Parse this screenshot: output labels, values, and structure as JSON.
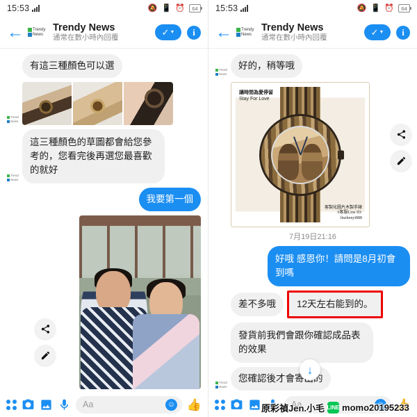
{
  "status_bar": {
    "time": "15:53",
    "signal_icon": "signal-bars-icon",
    "mute_icon": "bell-muted-icon",
    "vibrate_icon": "vibrate-icon",
    "alarm_icon": "alarm-clock-icon",
    "battery_level": "64"
  },
  "header": {
    "back_icon": "back-arrow-icon",
    "avatar_name": "Trendy News",
    "avatar_line1": "Trendy",
    "avatar_line2": "News",
    "title": "Trendy News",
    "subtitle": "通常在數小時內回覆",
    "check_icon": "check-dropdown-icon",
    "info_icon": "info-icon"
  },
  "colors": {
    "accent_blue": "#1b8ef2",
    "bubble_in": "#f0f0f0",
    "highlight_red": "#ee0000",
    "line_green": "#06c755",
    "logo_green": "#3cb54a"
  },
  "left_panel": {
    "messages": [
      {
        "id": "m1",
        "type": "text",
        "side": "in",
        "text": "有這三種顏色可以選"
      },
      {
        "id": "m2",
        "type": "photo_row",
        "side": "in",
        "photos": [
          "watch-photo-light-wood",
          "watch-photo-tan-wood",
          "watch-photo-dark-wood"
        ]
      },
      {
        "id": "m3",
        "type": "text",
        "side": "in",
        "text": "這三種顏色的草圖都會給您參考的，您看完後再選您最喜歡的就好"
      },
      {
        "id": "m4",
        "type": "text",
        "side": "out",
        "text": "我要第一個"
      },
      {
        "id": "m5",
        "type": "photo",
        "side": "out",
        "photo": "couple-yukata-photo"
      }
    ],
    "share_icon": "share-icon",
    "edit_icon": "pen-edit-icon",
    "scroll_down_icon": "scroll-to-bottom-icon"
  },
  "right_panel": {
    "messages": [
      {
        "id": "r1",
        "type": "text",
        "side": "in",
        "text": "好的，稍等哦"
      },
      {
        "id": "r2",
        "type": "card",
        "side": "in",
        "card": {
          "title_zh": "讓時間為愛停留",
          "title_en": "Stay For Love",
          "foot_line1": "客製化圖片木製手錶",
          "foot_line2": "6客服Line ID:",
          "foot_line3": "linzhenyi888",
          "image": "engraved-couple-wooden-watch"
        }
      },
      {
        "id": "r3",
        "type": "timestamp",
        "text": "7月19日21:16"
      },
      {
        "id": "r4",
        "type": "text",
        "side": "out",
        "text": "好哦 感恩你！請問是8月初會到嗎"
      },
      {
        "id": "r5",
        "type": "text_pair",
        "side": "in",
        "text": "差不多哦",
        "highlighted_text": "12天左右能到的。",
        "highlighted": true
      },
      {
        "id": "r6",
        "type": "text",
        "side": "in",
        "text": "發貨前我們會跟你確認成品表的效果"
      },
      {
        "id": "r7",
        "type": "text",
        "side": "in",
        "text": "您確認後才會寄出的"
      }
    ],
    "share_icon": "share-icon",
    "edit_icon": "pen-edit-icon",
    "scroll_down_icon": "scroll-to-bottom-icon"
  },
  "composer": {
    "menu_icon": "app-grid-icon",
    "camera_icon": "camera-icon",
    "gallery_icon": "gallery-icon",
    "mic_icon": "microphone-icon",
    "input_placeholder": "Aa",
    "input_value": "",
    "emoji_icon": "smiley-icon",
    "like_icon": "thumbs-up-icon"
  },
  "watermark": {
    "name": "原彩禎Jen.小毛",
    "line_icon": "line-app-icon",
    "line_label": "LINE",
    "account_id": "momo20195233"
  }
}
